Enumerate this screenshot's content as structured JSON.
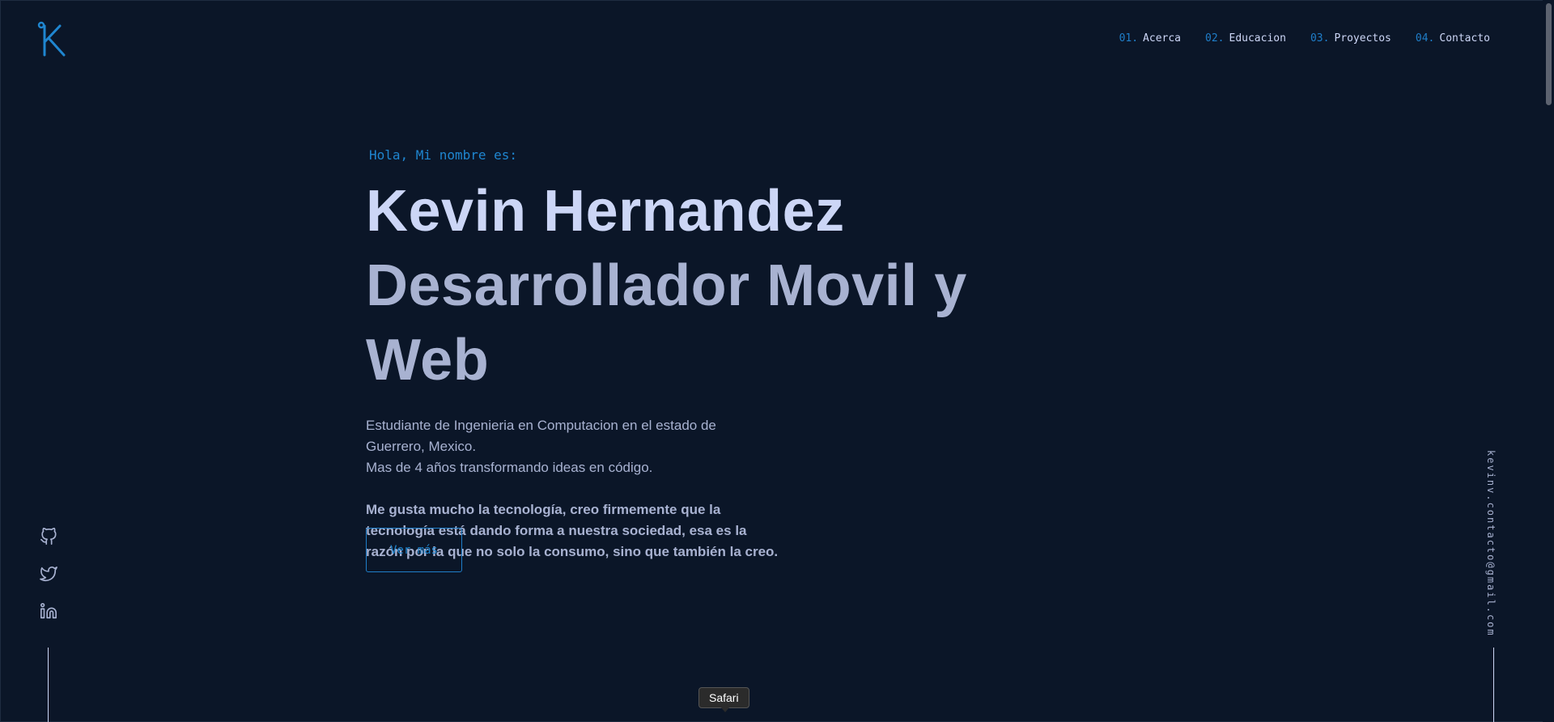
{
  "colors": {
    "background": "#0b1628",
    "accent": "#1f86d0",
    "text_light": "#ccd6f6",
    "text_slate": "#a8b2d1"
  },
  "logo": {
    "letter": "K",
    "icon": "k-logo-icon"
  },
  "nav": {
    "items": [
      {
        "num": "01.",
        "label": "Acerca"
      },
      {
        "num": "02.",
        "label": "Educacion"
      },
      {
        "num": "03.",
        "label": "Proyectos"
      },
      {
        "num": "04.",
        "label": "Contacto"
      }
    ]
  },
  "hero": {
    "greeting": "Hola, Mi nombre es:",
    "name": "Kevin Hernandez",
    "role": "Desarrollador Movil y Web",
    "description": [
      "Estudiante de Ingenieria en Computacion en el estado de Guerrero, Mexico.",
      "Mas de 4 años transformando ideas en código."
    ],
    "bold_text": "Me gusta mucho la tecnología, creo firmemente que la tecnología está dando forma a nuestra sociedad, esa es la razón por la que no solo la consumo, sino que también la creo.",
    "cta_label": "Ver más"
  },
  "socials": [
    {
      "icon": "github-icon"
    },
    {
      "icon": "twitter-icon"
    },
    {
      "icon": "linkedin-icon"
    }
  ],
  "email": "kevinv.contacto@gmail.com",
  "tooltip": "Safari"
}
